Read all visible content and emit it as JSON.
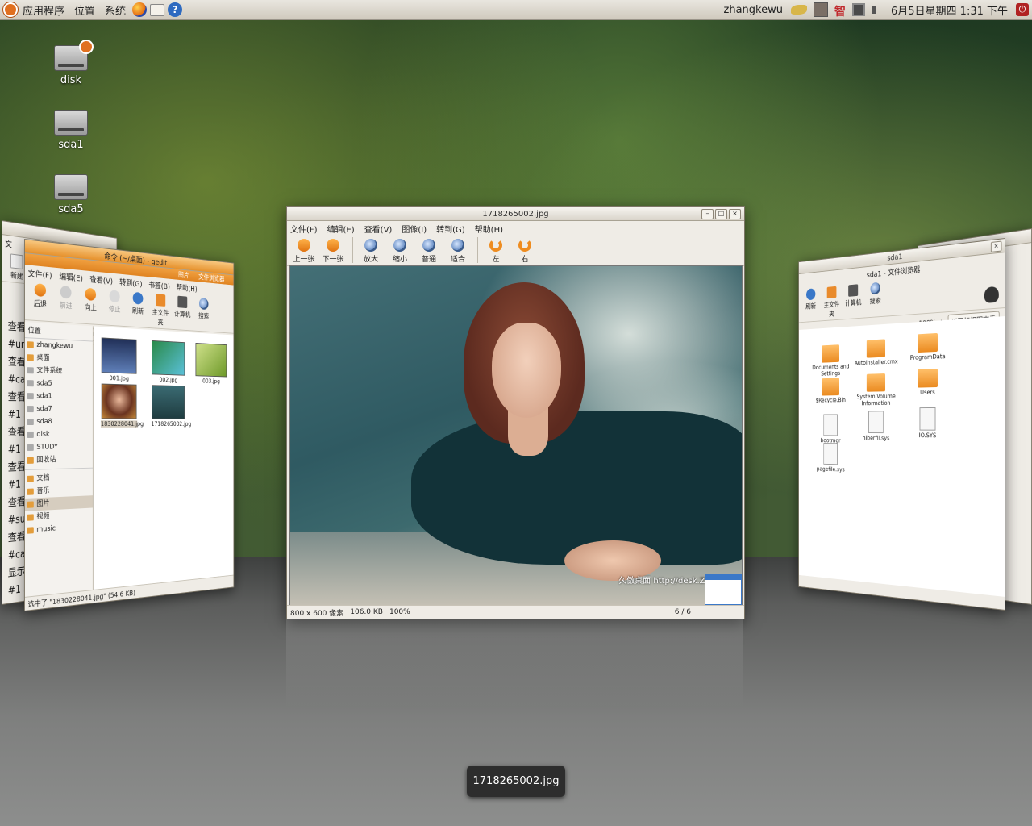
{
  "top_panel": {
    "menu": [
      "应用程序",
      "位置",
      "系统"
    ],
    "user": "zhangkewu",
    "tray_zhi": "智",
    "clock": "6月5日星期四  1:31 下午"
  },
  "desktop_icons": [
    {
      "label": "disk"
    },
    {
      "label": "sda1"
    },
    {
      "label": "sda5"
    }
  ],
  "viewer": {
    "title": "1718265002.jpg",
    "menu": [
      "文件(F)",
      "编辑(E)",
      "查看(V)",
      "图像(I)",
      "转到(G)",
      "帮助(H)"
    ],
    "toolbar": [
      "上一张",
      "下一张",
      "放大",
      "缩小",
      "普通",
      "适合",
      "左",
      "右"
    ],
    "watermark": "久傲桌面 http://desk.ZOL.Com",
    "status_size": "800 x 600 像素",
    "status_bytes": "106.0 KB",
    "status_zoom": "100%",
    "status_index": "6 / 6"
  },
  "left_back": {
    "toolbar_label": "新建",
    "menu_first": "文",
    "lines": [
      "查看",
      "#uni",
      "查看",
      "#ca",
      "查看",
      "#1 s",
      "查看",
      "#1 s",
      "查看",
      "#1 su",
      "查看",
      "#su",
      "查看",
      "#ca",
      "显示",
      "#1 s"
    ]
  },
  "nautilus_left": {
    "title": "命令 (~/桌面) - gedit",
    "tabs": [
      "图片",
      "文件浏览器"
    ],
    "menu": [
      "文件(F)",
      "编辑(E)",
      "查看(V)",
      "转到(G)",
      "书签(B)",
      "帮助(H)"
    ],
    "toolbar": [
      "后退",
      "前进",
      "向上",
      "停止",
      "刷新",
      "主文件夹",
      "计算机",
      "搜索"
    ],
    "path": [
      "zhangkewu",
      "图片"
    ],
    "side_header": "位置",
    "places": [
      "zhangkewu",
      "桌面",
      "文件系统",
      "sda5",
      "sda1",
      "sda7",
      "sda8",
      "disk",
      "STUDY",
      "回收站"
    ],
    "bookmarks": [
      "文档",
      "音乐",
      "图片",
      "视频",
      "music"
    ],
    "files": [
      "001.jpg",
      "002.jpg",
      "003.jpg",
      "1830228041.jpg",
      "1718265002.jpg"
    ],
    "status": "选中了 \"1830228041.jpg\" (54.6 KB)"
  },
  "nautilus_right": {
    "title": "sda1",
    "subtitle": "sda1 - 文件浏览器",
    "toolbar": [
      "刷新",
      "主文件夹",
      "计算机",
      "搜索"
    ],
    "zoom": "100%",
    "view_mode": "以图标视图查看",
    "items": [
      "Documents and Settings",
      "AutoInstaller.cmx",
      "ProgramData",
      "$Recycle.Bin",
      "System Volume Information",
      "Users",
      "bootmgr",
      "hiberfil.sys",
      "IO.SYS",
      "pagefile.sys"
    ]
  },
  "caption": "1718265002.jpg"
}
